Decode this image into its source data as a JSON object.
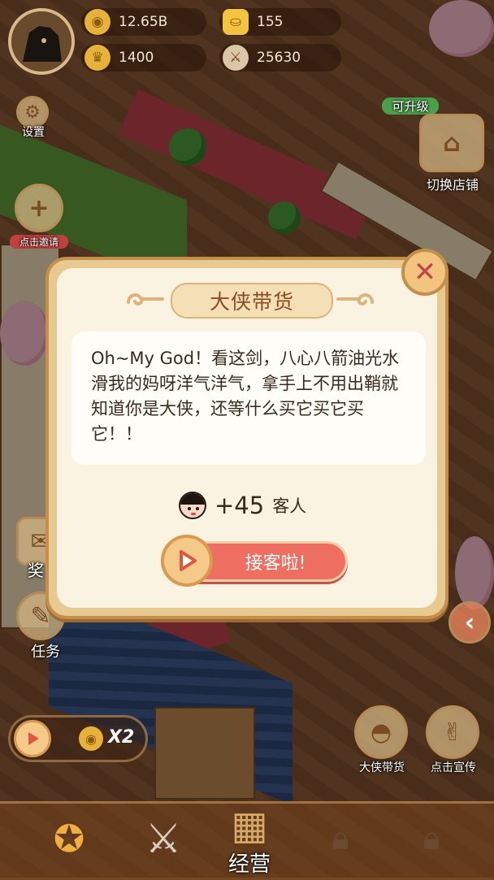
{
  "hud": {
    "coins": "12.65B",
    "gold": "155",
    "trophy": "1400",
    "sword": "25630"
  },
  "left_menu": {
    "settings_label": "设置",
    "invite_label": "点击邀请",
    "reward_label": "奖",
    "task_label": "任务"
  },
  "right_menu": {
    "upgrade_tag": "可升级",
    "switch_shop_label": "切换店铺",
    "hero_sale_label": "大侠带货",
    "promote_label": "点击宣传"
  },
  "speed": {
    "multiplier": "X2"
  },
  "bottom_bar": {
    "manage_label": "经营"
  },
  "dialog": {
    "title": "大侠带货",
    "message": "Oh~My God！看这剑，八心八箭油光水滑我的妈呀洋气洋气，拿手上不用出鞘就知道你是大侠，还等什么买它买它买它！！",
    "reward_amount": "+45",
    "reward_unit": "客人",
    "accept_button": "接客啦!"
  },
  "colors": {
    "dialog_border": "#c48e4c",
    "accept_button": "#ee6e62",
    "close_x": "#c1454a"
  }
}
